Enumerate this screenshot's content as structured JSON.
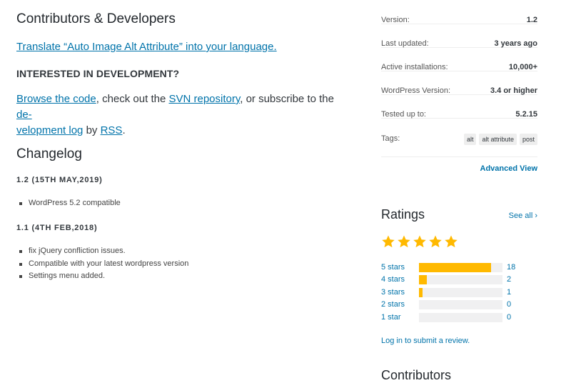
{
  "contributors": {
    "title": "Contributors & Developers",
    "translate_link": "Translate “Auto Image Alt Attribute” into your language."
  },
  "development": {
    "heading": "INTERESTED IN DEVELOPMENT?",
    "browse_code": "Browse the code",
    "text1": ", check out the ",
    "svn": "SVN repository",
    "text2": ", or subscribe to the ",
    "devlog": "development log",
    "text3": " by ",
    "rss": "RSS",
    "text4": "."
  },
  "changelog": {
    "title": "Changelog",
    "versions": [
      {
        "heading": "1.2 (15TH MAY,2019)",
        "items": [
          "WordPress 5.2 compatible"
        ]
      },
      {
        "heading": "1.1 (4TH FEB,2018)",
        "items": [
          "fix jQuery confliction issues.",
          "Compatible with your latest wordpress version",
          "Settings menu added."
        ]
      }
    ]
  },
  "meta": [
    {
      "label": "Version:",
      "value": "1.2"
    },
    {
      "label": "Last updated:",
      "value": "3 years ago"
    },
    {
      "label": "Active installations:",
      "value": "10,000+"
    },
    {
      "label": "WordPress Version:",
      "value": "3.4 or higher"
    },
    {
      "label": "Tested up to:",
      "value": "5.2.15"
    }
  ],
  "tags": {
    "label": "Tags:",
    "items": [
      "alt",
      "alt attribute",
      "post"
    ]
  },
  "advanced_view": "Advanced View",
  "ratings": {
    "title": "Ratings",
    "see_all": "See all",
    "stars_filled": 5,
    "star_color": "#ffb900",
    "breakdown": [
      {
        "label": "5 stars",
        "count": "18",
        "fraction": 0.86
      },
      {
        "label": "4 stars",
        "count": "2",
        "fraction": 0.09
      },
      {
        "label": "3 stars",
        "count": "1",
        "fraction": 0.045
      },
      {
        "label": "2 stars",
        "count": "0",
        "fraction": 0
      },
      {
        "label": "1 star",
        "count": "0",
        "fraction": 0
      }
    ],
    "login_review": "Log in to submit a review."
  },
  "contributors_side": "Contributors"
}
